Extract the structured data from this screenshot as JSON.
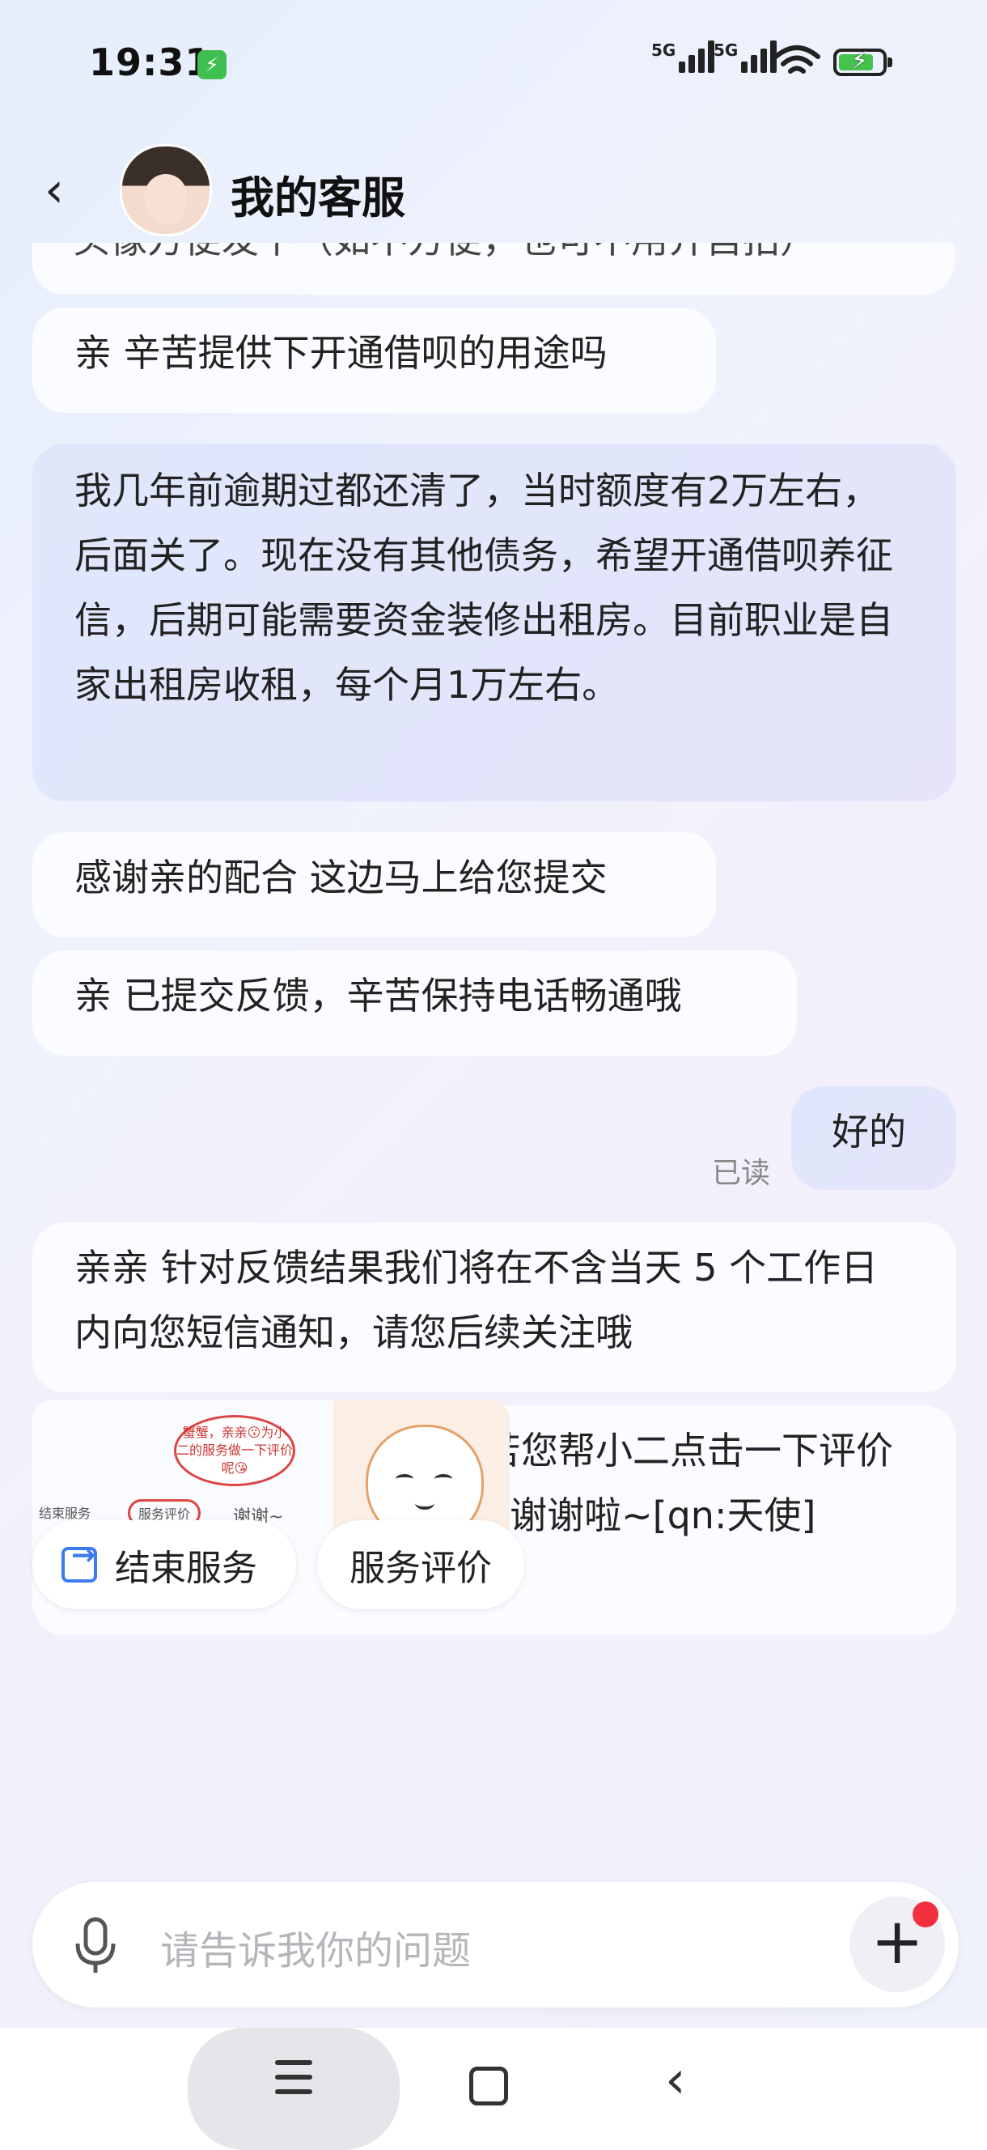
{
  "status": {
    "time": "19:31",
    "signal1": "5G",
    "signal2": "5G"
  },
  "header": {
    "title": "我的客服"
  },
  "messages": {
    "cutoff_text": "头像方便发下（如不方便，也可不用介自拍）",
    "m1": "亲 辛苦提供下开通借呗的用途吗",
    "m2": "我几年前逾期过都还清了，当时额度有2万左右，后面关了。现在没有其他债务，希望开通借呗养征信，后期可能需要资金装修出租房。目前职业是自家出租房收租，每个月1万左右。",
    "m3": "感谢亲的配合 这边马上给您提交",
    "m4": "亲 已提交反馈，辛苦保持电话畅通哦",
    "m5": "好的",
    "read_status": "已读",
    "m6": "亲亲 针对反馈结果我们将在不含当天 5 个工作日内向您短信通知，请您后续关注哦",
    "m7": "亲亲，如果方便的话，辛苦您帮小二点击一下评价叭，拜托拜托[ww:安慰]，谢谢啦~[qn:天使]"
  },
  "card": {
    "speech": "蟹蟹，亲亲😗为小二的服务做一下评价呢😘",
    "mini_end": "结束服务",
    "mini_rate": "服务评价",
    "mini_thanks": "谢谢~"
  },
  "quick_actions": {
    "end_service": "结束服务",
    "rate_service": "服务评价"
  },
  "input": {
    "placeholder": "请告诉我你的问题"
  }
}
